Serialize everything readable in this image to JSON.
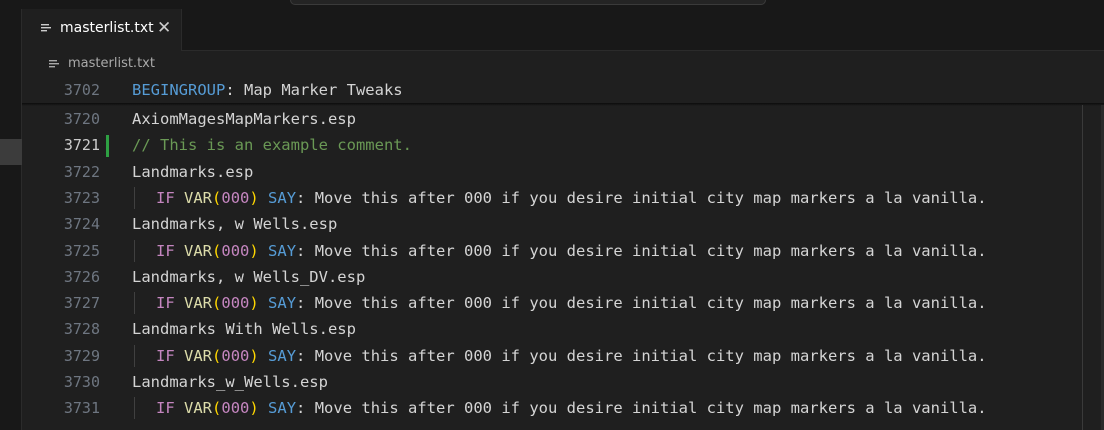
{
  "tab": {
    "label": "masterlist.txt",
    "file_icon": "file-lines-icon",
    "close_glyph": "✕",
    "close_icon": "close-icon"
  },
  "breadcrumb": {
    "label": "masterlist.txt",
    "file_icon": "file-lines-icon"
  },
  "editor": {
    "sticky": {
      "number": "3702",
      "keyword": "BEGINGROUP",
      "rest": ": Map Marker Tweaks"
    },
    "active_line": "3721",
    "lines": [
      {
        "number": "3720",
        "text": "AxiomMagesMapMarkers.esp"
      },
      {
        "number": "3721",
        "comment": "// This is an example comment."
      },
      {
        "number": "3722",
        "text": "Landmarks.esp"
      },
      {
        "number": "3723",
        "cond": {
          "op": "IF",
          "fn": "VAR",
          "open": "(",
          "arg": "000",
          "close": ")",
          "say": "SAY",
          "msg": ": Move this after 000 if you desire initial city map markers a la vanilla."
        }
      },
      {
        "number": "3724",
        "text": "Landmarks, w Wells.esp"
      },
      {
        "number": "3725",
        "cond": {
          "op": "IF",
          "fn": "VAR",
          "open": "(",
          "arg": "000",
          "close": ")",
          "say": "SAY",
          "msg": ": Move this after 000 if you desire initial city map markers a la vanilla."
        }
      },
      {
        "number": "3726",
        "text": "Landmarks, w Wells_DV.esp"
      },
      {
        "number": "3727",
        "cond": {
          "op": "IF",
          "fn": "VAR",
          "open": "(",
          "arg": "000",
          "close": ")",
          "say": "SAY",
          "msg": ": Move this after 000 if you desire initial city map markers a la vanilla."
        }
      },
      {
        "number": "3728",
        "text": "Landmarks With Wells.esp"
      },
      {
        "number": "3729",
        "cond": {
          "op": "IF",
          "fn": "VAR",
          "open": "(",
          "arg": "000",
          "close": ")",
          "say": "SAY",
          "msg": ": Move this after 000 if you desire initial city map markers a la vanilla."
        }
      },
      {
        "number": "3730",
        "text": "Landmarks_w_Wells.esp"
      },
      {
        "number": "3731",
        "cond": {
          "op": "IF",
          "fn": "VAR",
          "open": "(",
          "arg": "000",
          "close": ")",
          "say": "SAY",
          "msg": ": Move this after 000 if you desire initial city map markers a la vanilla."
        }
      }
    ]
  },
  "colors": {
    "background": "#1f1f1f",
    "keyword": "#569cd6",
    "control": "#c586c0",
    "function": "#dcdcaa",
    "bracket": "#ffd700",
    "comment": "#6a9955",
    "modified_marker": "#2ea043"
  }
}
